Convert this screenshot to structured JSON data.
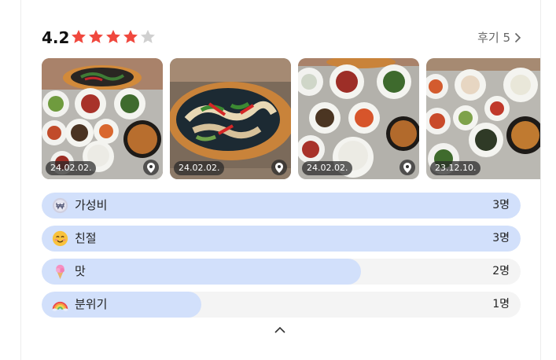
{
  "rating": {
    "score": "4.2",
    "stars_filled": 4,
    "stars_total": 5,
    "star_color": "#f0483e",
    "star_empty_color": "#d0d0d0"
  },
  "reviews_link": {
    "label": "후기 5",
    "icon": "chevron-right-icon"
  },
  "photos": [
    {
      "date": "24.02.02.",
      "has_location": true
    },
    {
      "date": "24.02.02.",
      "has_location": true
    },
    {
      "date": "24.02.02.",
      "has_location": true
    },
    {
      "date": "23.12.10.",
      "has_location": false
    }
  ],
  "keywords": [
    {
      "label": "가성비",
      "count": "3명",
      "ratio": 1.0,
      "icon": "won-coin-icon"
    },
    {
      "label": "친절",
      "count": "3명",
      "ratio": 1.0,
      "icon": "smiling-face-icon"
    },
    {
      "label": "맛",
      "count": "2명",
      "ratio": 0.667,
      "icon": "ice-cream-icon"
    },
    {
      "label": "분위기",
      "count": "1명",
      "ratio": 0.333,
      "icon": "rainbow-icon"
    }
  ],
  "colors": {
    "bar_fill": "#d2e0fb",
    "bar_track": "#f4f4f4"
  },
  "collapse_icon": "chevron-up-icon"
}
